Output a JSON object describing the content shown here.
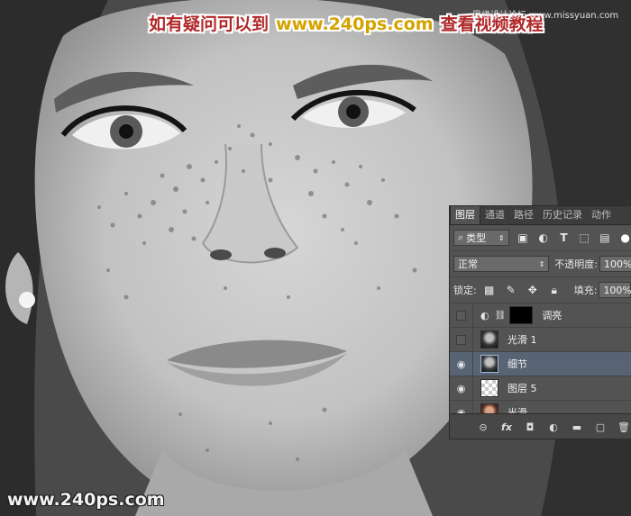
{
  "captions": {
    "top_part1": "如有疑问可以到",
    "top_site": "www.240ps.com",
    "top_part2": "查看视频教程",
    "top_right": "思缘设计论坛 www.missyuan.com",
    "bottom_left": "www.240ps.com"
  },
  "panel": {
    "tabs": [
      "图层",
      "通道",
      "路径",
      "历史记录",
      "动作"
    ],
    "filter_kind": "类型",
    "blend_mode": "正常",
    "opacity_label": "不透明度:",
    "opacity_value": "100%",
    "lock_label": "锁定:",
    "fill_label": "填充:",
    "fill_value": "100%",
    "layers": [
      {
        "name": "调亮",
        "visible": false,
        "thumb": "adjustment-mask"
      },
      {
        "name": "光滑 1",
        "visible": false,
        "thumb": "face-bw"
      },
      {
        "name": "细节",
        "visible": true,
        "thumb": "face-bw",
        "selected": true
      },
      {
        "name": "图层 5",
        "visible": true,
        "thumb": "transparent"
      },
      {
        "name": "光滑",
        "visible": true,
        "thumb": "face-color"
      }
    ],
    "bottom_icons": [
      "link-icon",
      "fx-icon",
      "mask-icon",
      "adjustment-icon",
      "folder-icon",
      "new-layer-icon",
      "trash-icon"
    ]
  }
}
